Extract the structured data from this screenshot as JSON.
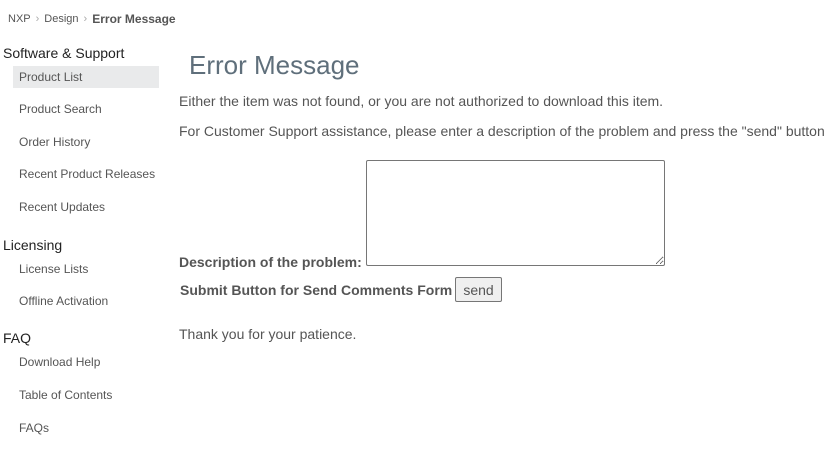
{
  "breadcrumb": {
    "items": [
      "NXP",
      "Design"
    ],
    "separator": "›",
    "current": "Error Message"
  },
  "sidebar": {
    "sections": [
      {
        "heading": "Software & Support",
        "items": [
          {
            "label": "Product List",
            "active": true
          },
          {
            "label": "Product Search"
          },
          {
            "label": "Order History"
          },
          {
            "label": "Recent Product Releases"
          },
          {
            "label": "Recent Updates"
          }
        ]
      },
      {
        "heading": "Licensing",
        "items": [
          {
            "label": "License Lists"
          },
          {
            "label": "Offline Activation"
          }
        ]
      },
      {
        "heading": "FAQ",
        "items": [
          {
            "label": "Download Help"
          },
          {
            "label": "Table of Contents"
          },
          {
            "label": "FAQs"
          }
        ]
      }
    ]
  },
  "main": {
    "title": "Error Message",
    "message": "Either the item was not found, or you are not authorized to download this item.",
    "support_text": "For Customer Support assistance, please enter a description of the problem and press the \"send\" button",
    "description_label": "Description of the problem:",
    "description_value": "",
    "submit_label": "Submit Button for Send Comments Form",
    "send_button": "send",
    "thanks": "Thank you for your patience."
  },
  "colors": {
    "title": "#5f6f7b",
    "text": "#555555",
    "active_bg": "#e9eaeb"
  }
}
